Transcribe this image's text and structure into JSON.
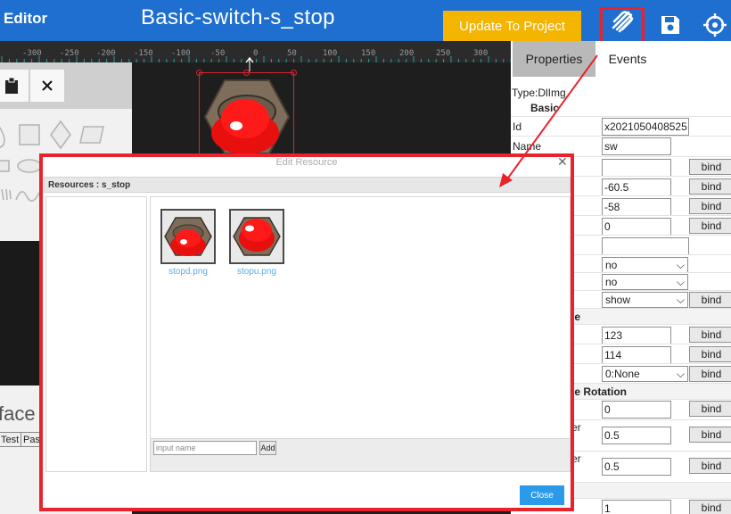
{
  "header": {
    "app_title": "Editor",
    "doc_title": "Basic-switch-s_stop",
    "update_label": "Update To Project"
  },
  "ruler": {
    "labels": [
      "-300",
      "-250",
      "-200",
      "-150",
      "-100",
      "-50",
      "0",
      "50",
      "100",
      "150",
      "200",
      "250",
      "300"
    ]
  },
  "toolbox": {
    "face_text": "face",
    "test_label": "Test",
    "paste_label": "Pas"
  },
  "properties": {
    "tabs": [
      "Properties",
      "Events"
    ],
    "type_text": "Type:DlImg",
    "section_basic": "Basic",
    "section_scale": "le",
    "section_rotation": "le Rotation",
    "bind_label": "bind",
    "rows": {
      "id_label": "Id",
      "id_value": "x2021050408525",
      "name_label": "Name",
      "name_value": "sw",
      "x_value": "-60.5",
      "y_value": "-58",
      "rot_value": "0",
      "sel1": "no",
      "sel2": "no",
      "sel3": "show",
      "w_value": "123",
      "h_value": "114",
      "sel4": "0:None",
      "r0_value": "0",
      "r1_label": "er",
      "r1_value": "0.5",
      "r2_label": "er",
      "r2_value": "0.5",
      "last_value": "1"
    }
  },
  "modal": {
    "title": "Edit Resource",
    "resources_label": "Resources : s_stop",
    "files": [
      {
        "name": "stopd.png"
      },
      {
        "name": "stopu.png"
      }
    ],
    "name_placeholder": "input name",
    "add_label": "Add",
    "close_label": "Close"
  },
  "colors": {
    "header": "#1e6fcf",
    "update": "#f5b400",
    "highlight": "#e8232c",
    "close": "#2b9ae8"
  }
}
